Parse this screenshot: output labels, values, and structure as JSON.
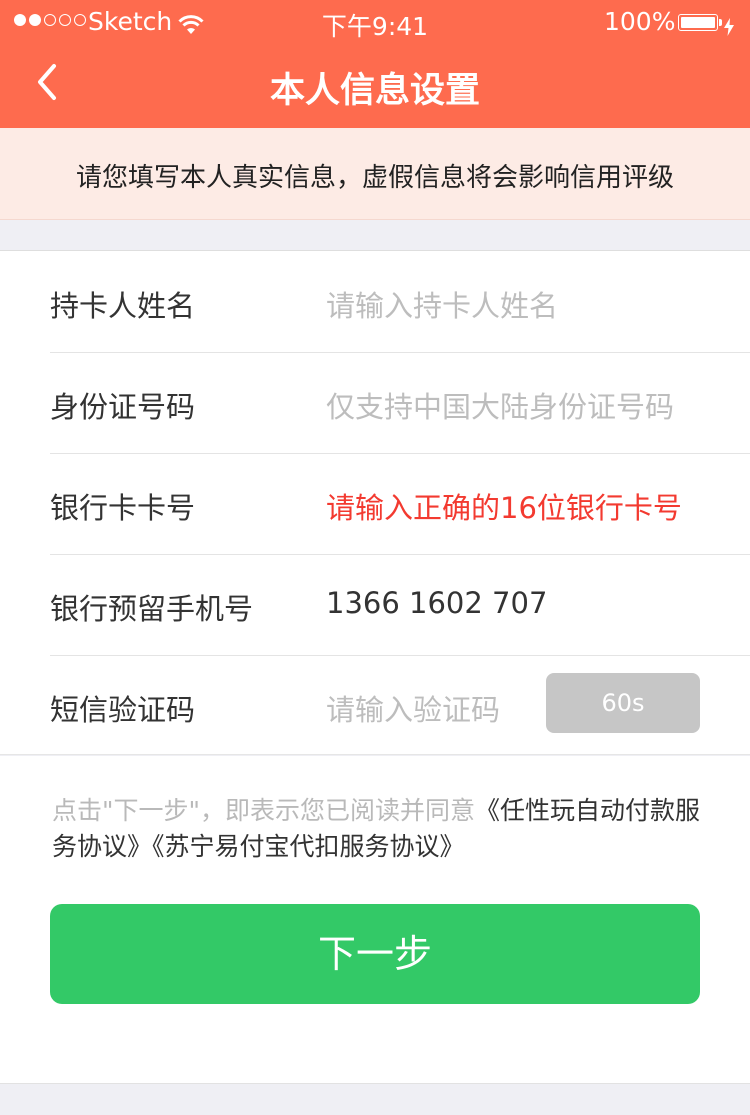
{
  "status_bar": {
    "carrier": "Sketch",
    "time": "下午9:41",
    "battery": "100%",
    "signal_bars": 2,
    "signal_total": 5
  },
  "nav": {
    "title": "本人信息设置",
    "back_icon": "chevron-left-icon"
  },
  "notice": {
    "text": "请您填写本人真实信息，虚假信息将会影响信用评级"
  },
  "form": {
    "rows": [
      {
        "label": "持卡人姓名",
        "value": "请输入持卡人姓名",
        "state": "placeholder"
      },
      {
        "label": "身份证号码",
        "value": "仅支持中国大陆身份证号码",
        "state": "placeholder"
      },
      {
        "label": "银行卡卡号",
        "value": "请输入正确的16位银行卡号",
        "state": "error"
      },
      {
        "label": "银行预留手机号",
        "value": "1366 1602 707",
        "state": "filled"
      },
      {
        "label": "短信验证码",
        "value": "请输入验证码",
        "state": "placeholder"
      }
    ],
    "code_button": "60s"
  },
  "agreement": {
    "prefix": "点击\"下一步\"，即表示您已阅读并同意",
    "link1": "《任性玩自动付款服务协议》",
    "link2": "《苏宁易付宝代扣服务协议》"
  },
  "next_button": "下一步",
  "colors": {
    "header": "#fe6b4e",
    "notice_bg": "#fdebe5",
    "error": "#f33a30",
    "button": "#33c967",
    "code_button": "#c6c6c6"
  }
}
